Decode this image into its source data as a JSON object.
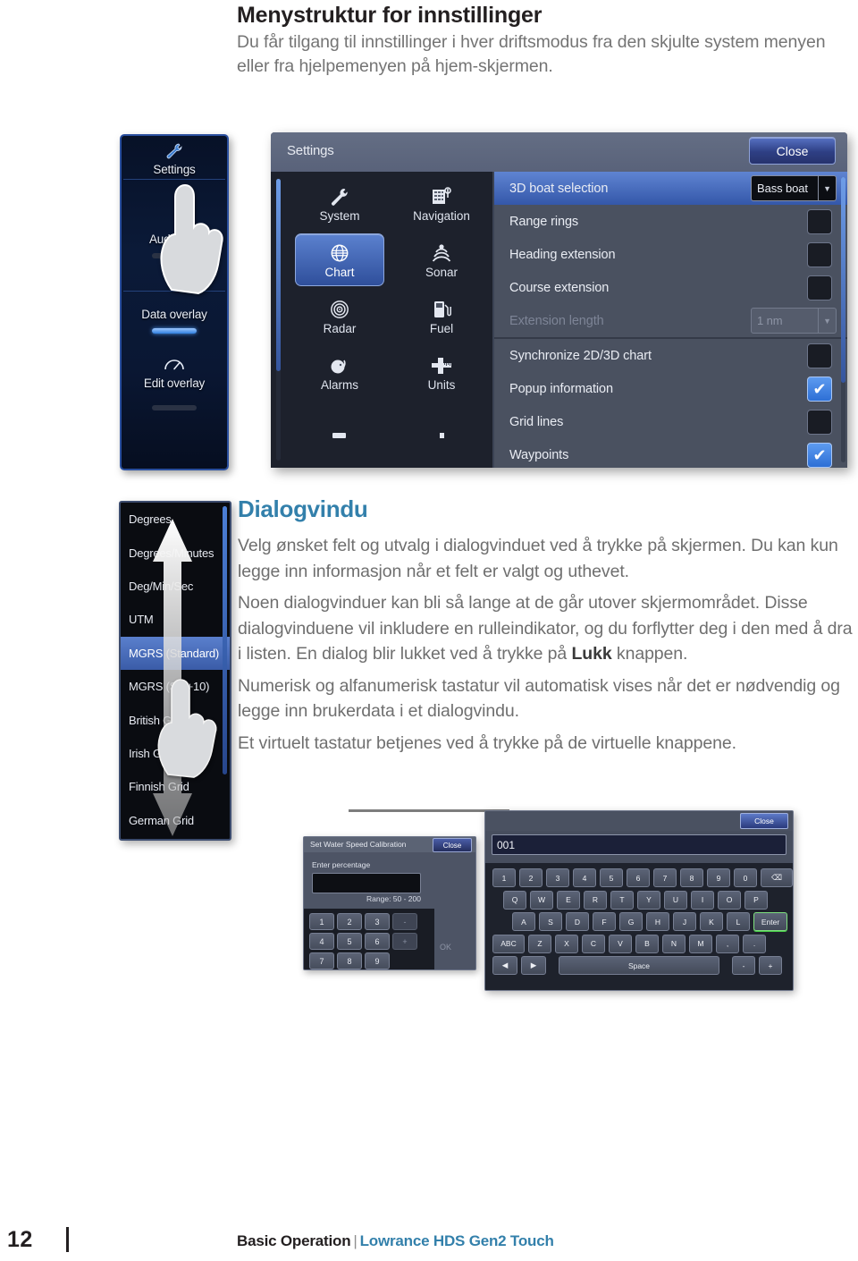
{
  "document": {
    "title": "Menystruktur for innstillinger",
    "intro": "Du får tilgang til innstillinger i hver driftsmodus fra den skjulte system menyen eller fra hjelpemenyen på hjem-skjermen.",
    "section_heading": "Dialogvindu",
    "paragraph_1": "Velg ønsket felt og utvalg i dialogvinduet ved å trykke på skjermen. Du kan kun legge inn informasjon når et felt er valgt og uthevet.",
    "paragraph_2a": "Noen dialogvinduer kan bli så lange at de går utover skjermområdet. Disse dialogvinduene vil inkludere en rulleindikator, og du forflytter deg i den med å dra i listen. En dialog blir lukket ved å trykke på ",
    "paragraph_2b": "Lukk",
    "paragraph_2c": " knappen.",
    "paragraph_3": "Numerisk og alfanumerisk tastatur vil automatisk vises når det er nødvendig og legge inn brukerdata i et dialogvindu.",
    "paragraph_4": "Et virtuelt tastatur betjenes ved å trykke på de virtuelle knappene."
  },
  "footer": {
    "page_number": "12",
    "section": "Basic Operation",
    "separator": "|",
    "product": "Lowrance HDS Gen2 Touch"
  },
  "sidebar": {
    "items": [
      {
        "label": "Settings",
        "icon": "wrench-icon"
      },
      {
        "label": "Audio bar",
        "icon": "none",
        "toggle": "off"
      },
      {
        "label": "Data overlay",
        "icon": "none",
        "toggle": "on"
      },
      {
        "label": "Edit overlay",
        "icon": "gauge-icon"
      }
    ]
  },
  "settings_dialog": {
    "title": "Settings",
    "close_label": "Close",
    "categories": [
      {
        "label": "System",
        "icon": "wrench-icon",
        "selected": false
      },
      {
        "label": "Navigation",
        "icon": "navigation-icon",
        "selected": false
      },
      {
        "label": "Chart",
        "icon": "globe-icon",
        "selected": true
      },
      {
        "label": "Sonar",
        "icon": "sonar-icon",
        "selected": false
      },
      {
        "label": "Radar",
        "icon": "radar-icon",
        "selected": false
      },
      {
        "label": "Fuel",
        "icon": "fuel-icon",
        "selected": false
      },
      {
        "label": "Alarms",
        "icon": "alarm-icon",
        "selected": false
      },
      {
        "label": "Units",
        "icon": "units-icon",
        "selected": false
      }
    ],
    "options": [
      {
        "label": "3D boat selection",
        "type": "select",
        "value": "Bass boat",
        "highlighted": true
      },
      {
        "label": "Range rings",
        "type": "checkbox",
        "checked": false
      },
      {
        "label": "Heading extension",
        "type": "checkbox",
        "checked": false
      },
      {
        "label": "Course extension",
        "type": "checkbox",
        "checked": false
      },
      {
        "label": "Extension length",
        "type": "select",
        "value": "1 nm",
        "disabled": true
      },
      {
        "label": "Synchronize 2D/3D chart",
        "type": "checkbox",
        "checked": false
      },
      {
        "label": "Popup information",
        "type": "checkbox",
        "checked": true
      },
      {
        "label": "Grid lines",
        "type": "checkbox",
        "checked": false
      },
      {
        "label": "Waypoints",
        "type": "checkbox",
        "checked": true
      }
    ]
  },
  "coordinate_list": {
    "items": [
      {
        "label": "Degrees",
        "selected": false
      },
      {
        "label": "Degrees/Minutes",
        "selected": false
      },
      {
        "label": "Deg/Min/Sec",
        "selected": false
      },
      {
        "label": "UTM",
        "selected": false
      },
      {
        "label": "MGRS (Standard)",
        "selected": true
      },
      {
        "label": "MGRS (Std+10)",
        "selected": false
      },
      {
        "label": "British Grid",
        "selected": false
      },
      {
        "label": "Irish Grid",
        "selected": false
      },
      {
        "label": "Finnish Grid",
        "selected": false
      },
      {
        "label": "German Grid",
        "selected": false
      }
    ]
  },
  "calibration_dialog": {
    "title": "Set Water Speed Calibration",
    "close_label": "Close",
    "field_label": "Enter percentage",
    "field_value": "",
    "range_text": "Range: 50 - 200",
    "ok_label": "OK",
    "keypad_rows": [
      [
        "1",
        "2",
        "3",
        "-"
      ],
      [
        "4",
        "5",
        "6",
        "+"
      ],
      [
        "7",
        "8",
        "9",
        ""
      ]
    ]
  },
  "keyboard_dialog": {
    "close_label": "Close",
    "input_value": "001",
    "rows": [
      [
        "1",
        "2",
        "3",
        "4",
        "5",
        "6",
        "7",
        "8",
        "9",
        "0",
        "⌫"
      ],
      [
        "Q",
        "W",
        "E",
        "R",
        "T",
        "Y",
        "U",
        "I",
        "O",
        "P"
      ],
      [
        "A",
        "S",
        "D",
        "F",
        "G",
        "H",
        "J",
        "K",
        "L",
        "Enter"
      ],
      [
        "ABC",
        "Z",
        "X",
        "C",
        "V",
        "B",
        "N",
        "M",
        ",",
        "."
      ],
      [
        "◀",
        "▶",
        "Space",
        "-",
        "+"
      ]
    ]
  },
  "colors": {
    "accent_blue": "#3380ab",
    "body_text": "#6f6f6f",
    "heading_dark": "#231f20",
    "ui_selection": "#3457a9"
  }
}
